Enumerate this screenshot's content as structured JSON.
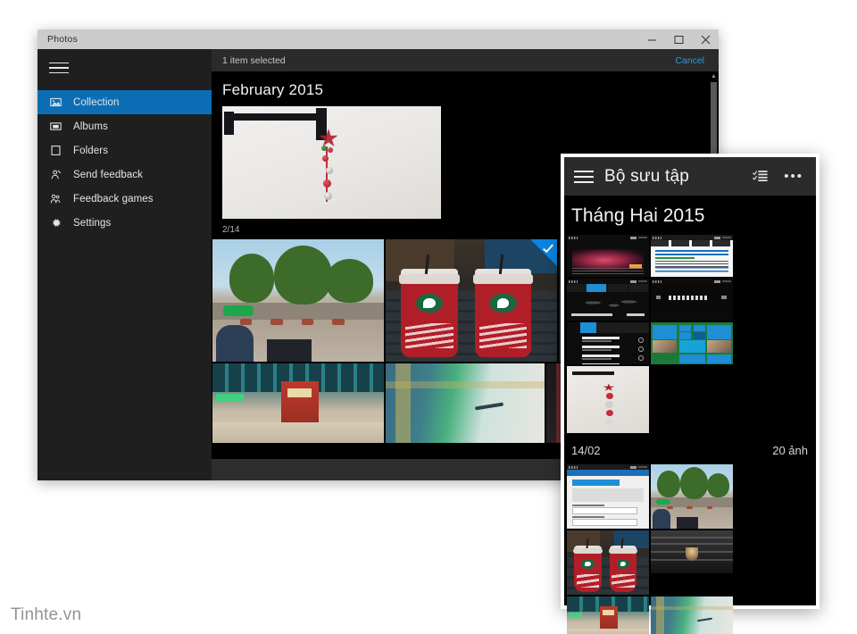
{
  "watermark": "Tinhte.vn",
  "desktop": {
    "window_title": "Photos",
    "window_controls": {
      "minimize": "minimize-button",
      "maximize": "maximize-button",
      "close": "close-button"
    },
    "hamburger_label": "Menu",
    "sidebar": {
      "items": [
        {
          "label": "Collection",
          "icon": "collection-icon",
          "active": true
        },
        {
          "label": "Albums",
          "icon": "albums-icon",
          "active": false
        },
        {
          "label": "Folders",
          "icon": "folders-icon",
          "active": false
        },
        {
          "label": "Send feedback",
          "icon": "send-feedback-icon",
          "active": false
        },
        {
          "label": "Feedback games",
          "icon": "feedback-games-icon",
          "active": false
        },
        {
          "label": "Settings",
          "icon": "gear-icon",
          "active": false
        }
      ]
    },
    "command_bar": {
      "selection_text": "1 item selected",
      "cancel_label": "Cancel",
      "cancel_color": "#2f9bdf"
    },
    "month_heading": "February 2015",
    "date_subheading": "2/14",
    "selection_accent": "#0a84e0",
    "tiles": [
      {
        "name": "park-trees-photo",
        "selected": false
      },
      {
        "name": "merry-christmas-cups-photo",
        "selected": true
      },
      {
        "name": "dark-edge-photo",
        "selected": false
      },
      {
        "name": "mall-interior-photo",
        "selected": false
      },
      {
        "name": "green-blur-photo",
        "selected": false
      },
      {
        "name": "rail-edge-photo",
        "selected": false
      }
    ],
    "hero_photo": "christmas-ornament-photo"
  },
  "phone": {
    "header": {
      "title": "Bộ sưu tập",
      "hamburger": "menu-icon",
      "select_icon": "select-items-icon",
      "more_icon": "more-options-icon"
    },
    "month_heading": "Tháng Hai 2015",
    "day_label": "14/02",
    "count_label": "20 ảnh",
    "thumbnails_row1": [
      "bing-nebula-screenshot",
      "search-results-screenshot",
      "world-clock-screenshot"
    ],
    "thumbnails_row2": [
      "dialer-screenshot",
      "call-history-screenshot",
      "start-screen-screenshot"
    ],
    "thumbnails_row3": [
      "christmas-ornament-photo"
    ],
    "thumbnails_row4": [
      "windows-feedback-screenshot",
      "park-trees-photo",
      "merry-christmas-cups-photo"
    ],
    "thumbnails_row5": [
      "ceiling-lamp-photo",
      "mall-interior-photo",
      "green-blur-photo"
    ]
  }
}
